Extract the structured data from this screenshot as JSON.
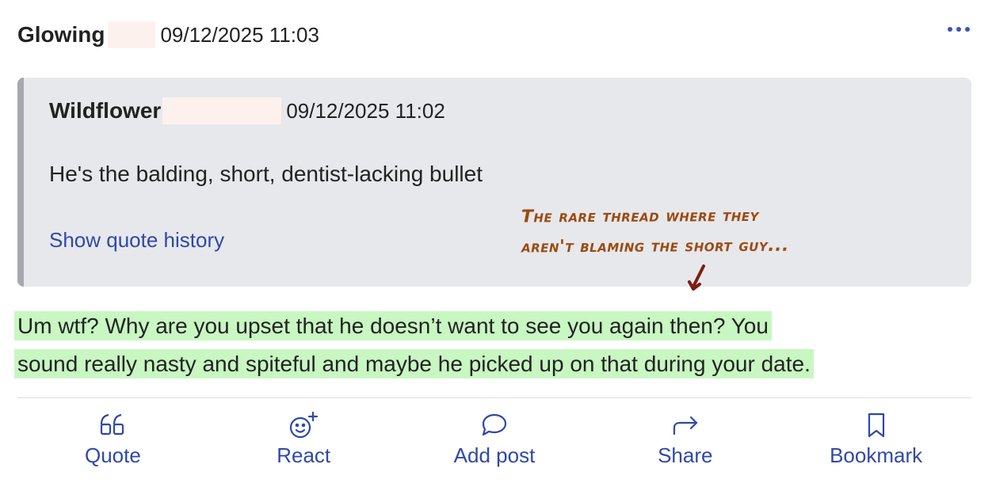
{
  "post": {
    "author": "Glowing",
    "timestamp": "09/12/2025 11:03",
    "more_icon": "ellipsis-icon"
  },
  "quote": {
    "author": "Wildflower",
    "timestamp": "09/12/2025 11:02",
    "text": "He's the balding, short, dentist-lacking bullet",
    "history_link": "Show quote history"
  },
  "annotation": {
    "line1": "The rare thread where they",
    "line2": "aren't blaming the short guy...",
    "color": "#9c4a0e"
  },
  "reply": {
    "line1": "Um wtf? Why are you upset that he doesn’t want to see you again then? You",
    "line2": "sound really nasty and spiteful and maybe he picked up on that during your date.",
    "highlight_color": "#c8f7c2"
  },
  "actions": [
    {
      "label": "Quote",
      "icon": "quote-icon"
    },
    {
      "label": "React",
      "icon": "react-smiley-icon"
    },
    {
      "label": "Add post",
      "icon": "speech-bubble-icon"
    },
    {
      "label": "Share",
      "icon": "share-arrow-icon"
    },
    {
      "label": "Bookmark",
      "icon": "bookmark-icon"
    }
  ],
  "colors": {
    "link": "#3048a8",
    "quote_bg": "#e7e8ec",
    "quote_bar": "#a6a8b0"
  }
}
